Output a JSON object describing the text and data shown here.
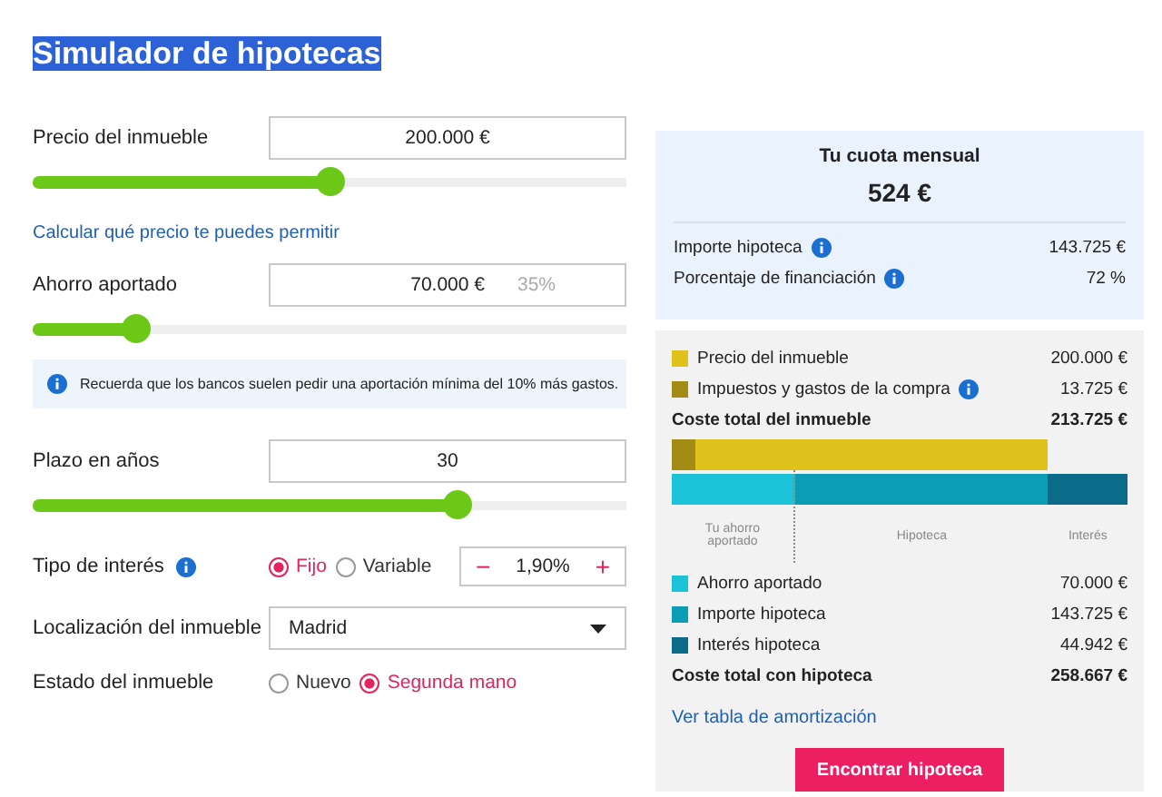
{
  "title": "Simulador de hipotecas",
  "form": {
    "price": {
      "label": "Precio del inmueble",
      "value": "200.000 €",
      "level": 0.5
    },
    "afford_link": "Calcular qué precio te puedes permitir",
    "savings": {
      "label": "Ahorro aportado",
      "value": "70.000 €",
      "percent": "35%",
      "level": 0.175
    },
    "notice": "Recuerda que los bancos suelen pedir una aportación mínima del 10% más gastos.",
    "term": {
      "label": "Plazo en años",
      "value": "30",
      "level": 0.715
    },
    "interest": {
      "label": "Tipo de interés",
      "info": true,
      "options": [
        {
          "label": "Fijo",
          "selected": true
        },
        {
          "label": "Variable",
          "selected": false
        }
      ],
      "minus": "−",
      "rate": "1,90%",
      "plus": "+"
    },
    "location": {
      "label": "Localización del inmueble",
      "value": "Madrid"
    },
    "condition": {
      "label": "Estado del inmueble",
      "options": [
        {
          "label": "Nuevo",
          "selected": false
        },
        {
          "label": "Segunda mano",
          "selected": true
        }
      ]
    }
  },
  "summary": {
    "title": "Tu cuota mensual",
    "amount": "524 €",
    "rows": [
      {
        "label": "Importe hipoteca",
        "info": true,
        "value": "143.725 €"
      },
      {
        "label": "Porcentaje de financiación",
        "info": true,
        "value": "72 %"
      }
    ]
  },
  "breakdown": {
    "cost_items": [
      {
        "label": "Precio del inmueble",
        "info": false,
        "value": "200.000 €",
        "color": "#dfc21c"
      },
      {
        "label": "Impuestos y gastos de la compra",
        "info": true,
        "value": "13.725 €",
        "color": "#a38c14"
      }
    ],
    "cost_total": {
      "label": "Coste total del inmueble",
      "value": "213.725 €"
    },
    "financing_items": [
      {
        "label": "Ahorro aportado",
        "bar_label": "Tu ahorro aportado",
        "value": "70.000 €",
        "color": "#1cc3d8"
      },
      {
        "label": "Importe hipoteca",
        "bar_label": "Hipoteca",
        "value": "143.725 €",
        "color": "#0a9db3"
      },
      {
        "label": "Interés hipoteca",
        "bar_label": "Interés",
        "value": "44.942 €",
        "color": "#0b6b88"
      }
    ],
    "financing_total": {
      "label": "Coste total con hipoteca",
      "value": "258.667 €"
    },
    "link": "Ver tabla de amortización",
    "button": "Encontrar hipoteca"
  }
}
